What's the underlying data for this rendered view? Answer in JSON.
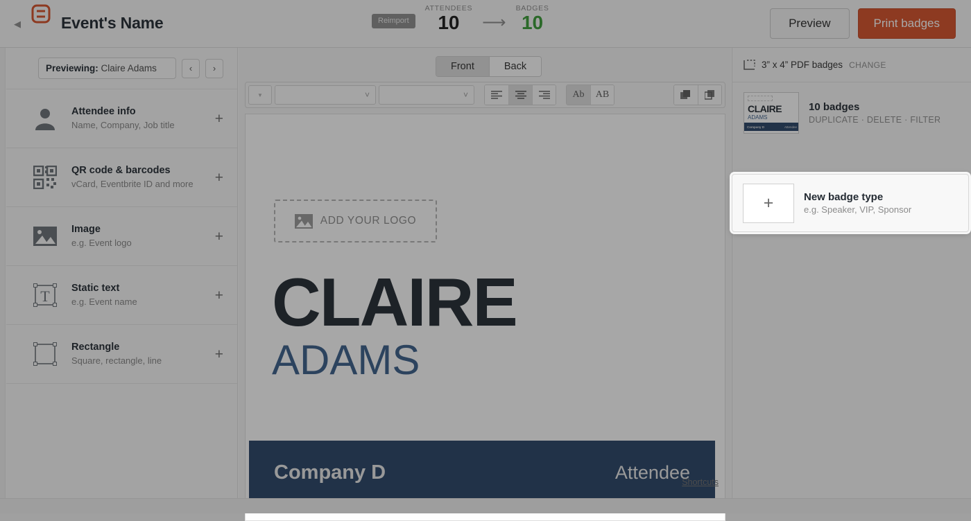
{
  "header": {
    "back_icon": "chevron-left-icon",
    "logo_icon": "event-badge-logo",
    "title": "Event's Name",
    "reimport_label": "Reimport",
    "attendees_label": "ATTENDEES",
    "attendees_value": "10",
    "arrow_icon": "arrow-right-icon",
    "badges_label": "BADGES",
    "badges_value": "10",
    "preview_label": "Preview",
    "print_label": "Print badges",
    "accent_color": "#d4512a",
    "badges_color": "#3a9c36"
  },
  "sidebar": {
    "previewing_label": "Previewing:",
    "previewing_value": "Claire Adams",
    "prev_icon": "chevron-left-icon",
    "next_icon": "chevron-right-icon",
    "items": [
      {
        "icon": "person-icon",
        "title": "Attendee info",
        "sub": "Name, Company, Job title",
        "add": "+"
      },
      {
        "icon": "qr-code-icon",
        "title": "QR code & barcodes",
        "sub": "vCard, Eventbrite ID and more",
        "add": "+"
      },
      {
        "icon": "image-icon",
        "title": "Image",
        "sub": "e.g. Event logo",
        "add": "+"
      },
      {
        "icon": "text-box-icon",
        "title": "Static text",
        "sub": "e.g. Event name",
        "add": "+"
      },
      {
        "icon": "rectangle-icon",
        "title": "Rectangle",
        "sub": "Square, rectangle, line",
        "add": "+"
      }
    ]
  },
  "canvas": {
    "tabs": [
      {
        "label": "Front",
        "active": true
      },
      {
        "label": "Back",
        "active": false
      }
    ],
    "toolbar": {
      "color_swatch_value": "",
      "font_family_value": "",
      "font_size_value": "",
      "align_left_icon": "align-left-icon",
      "align_center_icon": "align-center-icon",
      "align_right_icon": "align-right-icon",
      "case_mixed_label": "Ab",
      "case_upper_label": "AB",
      "bring_front_icon": "bring-to-front-icon",
      "send_back_icon": "send-to-back-icon"
    },
    "logo_placeholder": "ADD YOUR LOGO",
    "logo_icon": "image-icon",
    "first_name": "CLAIRE",
    "last_name": "ADAMS",
    "company": "Company D",
    "role": "Attendee",
    "footer_color": "#2a4568",
    "first_name_color": "#242b33",
    "last_name_color": "#3c5f8a",
    "shortcuts_label": "Shortcuts"
  },
  "right_panel": {
    "pdf_icon": "crop-size-icon",
    "pdf_size": "3” x 4” PDF badges",
    "pdf_change": "CHANGE",
    "badge_type": {
      "thumb_first": "CLAIRE",
      "thumb_last": "ADAMS",
      "thumb_company": "Company D",
      "thumb_role": "Attendee",
      "title": "10 badges",
      "actions": "DUPLICATE · DELETE · FILTER"
    },
    "new_badge": {
      "plus": "+",
      "title": "New badge type",
      "sub": "e.g. Speaker, VIP, Sponsor"
    }
  }
}
